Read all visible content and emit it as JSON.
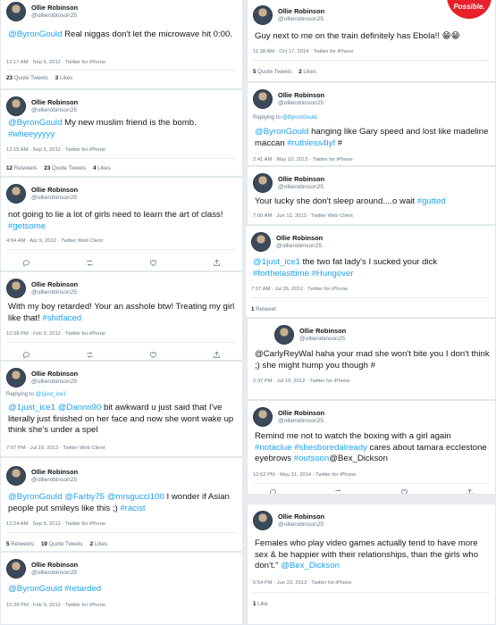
{
  "author": {
    "name": "Ollie Robinson",
    "handle": "@ollierobinson25"
  },
  "watermark_text": "Possible.",
  "left": [
    {
      "body": [
        {
          "t": "mention",
          "v": "@ByronGould"
        },
        {
          "t": "text",
          "v": "  Real niggas don't let the microwave hit 0:00."
        }
      ],
      "meta": "12:17 AM · Sep 5, 2012 · Twitter for iPhone",
      "stats": [
        {
          "n": "23",
          "l": "Quote Tweets"
        },
        {
          "n": "3",
          "l": "Likes"
        }
      ]
    },
    {
      "body": [
        {
          "t": "mention",
          "v": "@ByronGould"
        },
        {
          "t": "text",
          "v": "  My new muslim friend is the bomb. "
        },
        {
          "t": "hashtag",
          "v": "#wheeyyyyy"
        }
      ],
      "meta": "12:15 AM · Sep 5, 2012 · Twitter for iPhone",
      "stats": [
        {
          "n": "12",
          "l": "Retweets"
        },
        {
          "n": "23",
          "l": "Quote Tweets"
        },
        {
          "n": "4",
          "l": "Likes"
        }
      ]
    },
    {
      "body": [
        {
          "t": "text",
          "v": "not going to lie a lot of girls need to learn the art of class! "
        },
        {
          "t": "hashtag",
          "v": "#getsome"
        }
      ],
      "meta": "4:04 AM · Apr 9, 2012 · Twitter Web Client"
    },
    {
      "body": [
        {
          "t": "text",
          "v": "With my boy retarded! Your an asshole btw! Treating my girl like that! "
        },
        {
          "t": "hashtag",
          "v": "#shitfaced"
        }
      ],
      "meta": "10:38 PM · Feb 9, 2012 · Twitter for iPhone"
    },
    {
      "reply_prefix": "Replying to ",
      "reply_to": "@1just_ice1",
      "body": [
        {
          "t": "mention",
          "v": "@1just_ice1"
        },
        {
          "t": "text",
          "v": " "
        },
        {
          "t": "mention",
          "v": "@Dannn90"
        },
        {
          "t": "text",
          "v": " bit awkward u just said that I've literally just finished on her face and now she wont wake up think she's under a spel"
        }
      ],
      "meta": "7:07 PM · Jul 19, 2012 · Twitter Web Client"
    },
    {
      "body": [
        {
          "t": "mention",
          "v": "@ByronGould"
        },
        {
          "t": "text",
          "v": " "
        },
        {
          "t": "mention",
          "v": "@Farby75"
        },
        {
          "t": "text",
          "v": " "
        },
        {
          "t": "mention",
          "v": "@mrsgucci100"
        },
        {
          "t": "text",
          "v": "  I wonder if Asian people put smileys like this ;) "
        },
        {
          "t": "hashtag",
          "v": "#racist"
        }
      ],
      "meta": "12:24 AM · Sep 5, 2012 · Twitter for iPhone",
      "stats": [
        {
          "n": "5",
          "l": "Retweets"
        },
        {
          "n": "19",
          "l": "Quote Tweets"
        },
        {
          "n": "2",
          "l": "Likes"
        }
      ]
    },
    {
      "body": [
        {
          "t": "mention",
          "v": "@ByronGould"
        },
        {
          "t": "text",
          "v": " "
        },
        {
          "t": "hashtag",
          "v": "#retarded"
        }
      ],
      "meta": "10:39 PM · Feb 9, 2012 · Twitter for iPhone"
    }
  ],
  "right": [
    {
      "body": [
        {
          "t": "text",
          "v": "Guy next to me on the train definitely has Ebola!! 😁😁"
        }
      ],
      "meta": "11:38 AM · Oct 17, 2014 · Twitter for iPhone",
      "stats": [
        {
          "n": "5",
          "l": "Quote Tweets"
        },
        {
          "n": "2",
          "l": "Likes"
        }
      ]
    },
    {
      "reply_prefix": "Replying to ",
      "reply_to": "@ByronGould",
      "body": [
        {
          "t": "mention",
          "v": "@ByronGould"
        },
        {
          "t": "text",
          "v": " hanging like Gary speed and lost like madeline maccan "
        },
        {
          "t": "hashtag",
          "v": "#ruthless4lyf"
        },
        {
          "t": "text",
          "v": " #"
        }
      ],
      "meta": "2:41 AM · May 10, 2012 · Twitter for iPhone"
    },
    {
      "body": [
        {
          "t": "text",
          "v": "Your lucky she don't sleep around....o wait "
        },
        {
          "t": "hashtag",
          "v": "#gutted"
        }
      ],
      "meta": "7:00 AM · Jun 12, 2012 · Twitter Web Client"
    },
    {
      "body": [
        {
          "t": "mention",
          "v": "@1just_ice1"
        },
        {
          "t": "text",
          "v": " the two fat lady's I sucked your dick "
        },
        {
          "t": "hashtag",
          "v": "#forthelasttime"
        },
        {
          "t": "text",
          "v": " "
        },
        {
          "t": "hashtag",
          "v": "#Hungover"
        }
      ],
      "meta": "7:37 AM · Jul 26, 2012 · Twitter for iPhone",
      "stats": [
        {
          "n": "1",
          "l": "Retweet"
        }
      ]
    },
    {
      "body": [
        {
          "t": "text",
          "v": "@CarlyReyWal haha your mad she won't bite you I don't think ;) she might hump you though #"
        }
      ],
      "meta": "2:37 PM · Jul 10, 2012 · Twitter for iPhone"
    },
    {
      "body": [
        {
          "t": "text",
          "v": "Remind me not to watch the boxing with a girl again "
        },
        {
          "t": "hashtag",
          "v": "#notaclue"
        },
        {
          "t": "text",
          "v": " "
        },
        {
          "t": "hashtag",
          "v": "#shesboredalready"
        },
        {
          "t": "text",
          "v": " cares about tamara ecclestone eyebrows "
        },
        {
          "t": "hashtag",
          "v": "#outsoon"
        },
        {
          "t": "text",
          "v": "@Bex_Dickson"
        }
      ],
      "meta": "10:52 PM · May 31, 2014 · Twitter for iPhone"
    },
    {
      "body": [
        {
          "t": "text",
          "v": "Females who play video games actually tend to have more sex & be happier with their relationships, than the girls who don't.\" "
        },
        {
          "t": "mention",
          "v": "@Bex_Dickson"
        }
      ],
      "meta": "5:54 PM · Jun 23, 2013 · Twitter for iPhone",
      "stats": [
        {
          "n": "1",
          "l": "Like"
        }
      ]
    }
  ],
  "icons": [
    "reply-icon",
    "retweet-icon",
    "like-icon",
    "share-icon"
  ]
}
